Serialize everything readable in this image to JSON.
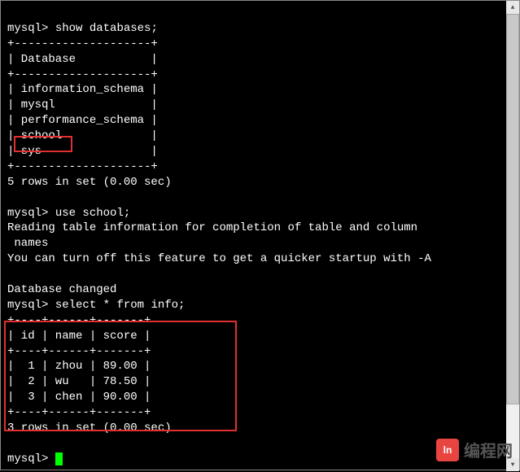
{
  "terminal": {
    "prompt": "mysql>",
    "command_1": "show databases;",
    "db_header_sep": "+--------------------+",
    "db_header": "| Database           |",
    "databases": [
      "| information_schema |",
      "| mysql              |",
      "| performance_schema |",
      "| school             |",
      "| sys                |"
    ],
    "db_result": "5 rows in set (0.00 sec)",
    "command_2": "use school;",
    "msg_1": "Reading table information for completion of table and column\n names",
    "msg_2": "You can turn off this feature to get a quicker startup with -A",
    "msg_3": "Database changed",
    "command_3": "select * from info;",
    "info_sep": "+----+------+-------+",
    "info_header": "| id | name | score |",
    "info_rows": [
      "|  1 | zhou | 89.00 |",
      "|  2 | wu   | 78.50 |",
      "|  3 | chen | 90.00 |"
    ],
    "info_result": "3 rows in set (0.00 sec)"
  },
  "chart_data": {
    "type": "table",
    "title": "info",
    "columns": [
      "id",
      "name",
      "score"
    ],
    "rows": [
      {
        "id": 1,
        "name": "zhou",
        "score": 89.0
      },
      {
        "id": 2,
        "name": "wu",
        "score": 78.5
      },
      {
        "id": 3,
        "name": "chen",
        "score": 90.0
      }
    ]
  },
  "watermark": {
    "icon_text": "ln",
    "text": "编程网"
  }
}
